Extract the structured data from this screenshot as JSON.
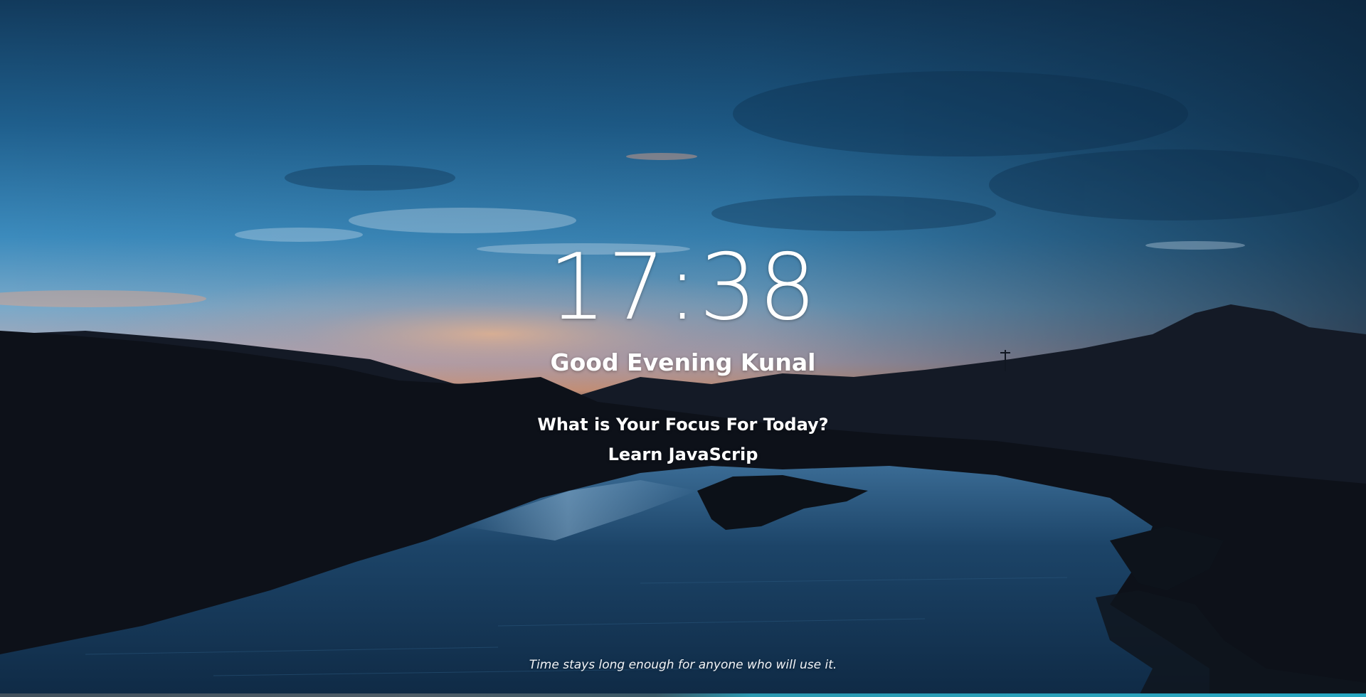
{
  "clock": {
    "time": "17:38"
  },
  "greeting": {
    "text": "Good Evening Kunal"
  },
  "focus": {
    "question": "What is Your Focus For Today?",
    "value": "Learn JavaScrip"
  },
  "quote": {
    "text": "Time stays long enough for anyone who will use it."
  },
  "colors": {
    "sky_top": "#123a5c",
    "sky_mid": "#2d77a8",
    "sunset": "#d99a7a",
    "hills": "#0f131b",
    "water": "#17324d"
  }
}
